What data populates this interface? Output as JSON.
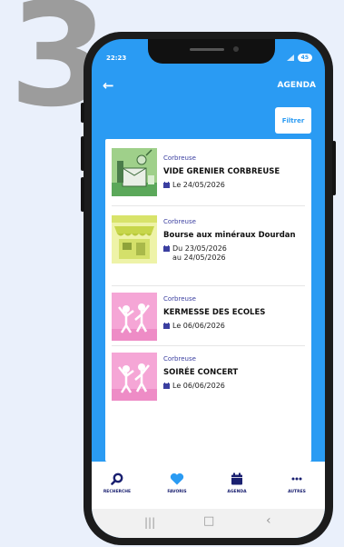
{
  "step_number": "3",
  "status_bar": {
    "time": "22:23",
    "battery": "45"
  },
  "app_bar": {
    "title": "AGENDA"
  },
  "filter": {
    "label": "Filtrer"
  },
  "events": [
    {
      "city": "Corbreuse",
      "title": "VIDE GRENIER CORBREUSE",
      "date": "Le 24/05/2026",
      "thumbnail": "vide-grenier-illustration"
    },
    {
      "city": "Corbreuse",
      "title": "Bourse aux minéraux Dourdan",
      "date": "Du 23/05/2026 au 24/05/2026",
      "thumbnail": "market-stall-illustration"
    },
    {
      "city": "Corbreuse",
      "title": "KERMESSE DES ECOLES",
      "date": "Le 06/06/2026",
      "thumbnail": "party-people-illustration"
    },
    {
      "city": "Corbreuse",
      "title": "SOIRÉE CONCERT",
      "date": "Le 06/06/2026",
      "thumbnail": "party-people-illustration"
    }
  ],
  "bottom_nav": [
    {
      "label": "RECHERCHE",
      "icon": "search-icon"
    },
    {
      "label": "FAVORIS",
      "icon": "heart-icon"
    },
    {
      "label": "AGENDA",
      "icon": "calendar-icon"
    },
    {
      "label": "AUTRES",
      "icon": "more-icon"
    }
  ],
  "colors": {
    "primary": "#2a9bf3",
    "nav_icon": "#1a2070",
    "page_bg": "#eaf0fb"
  }
}
